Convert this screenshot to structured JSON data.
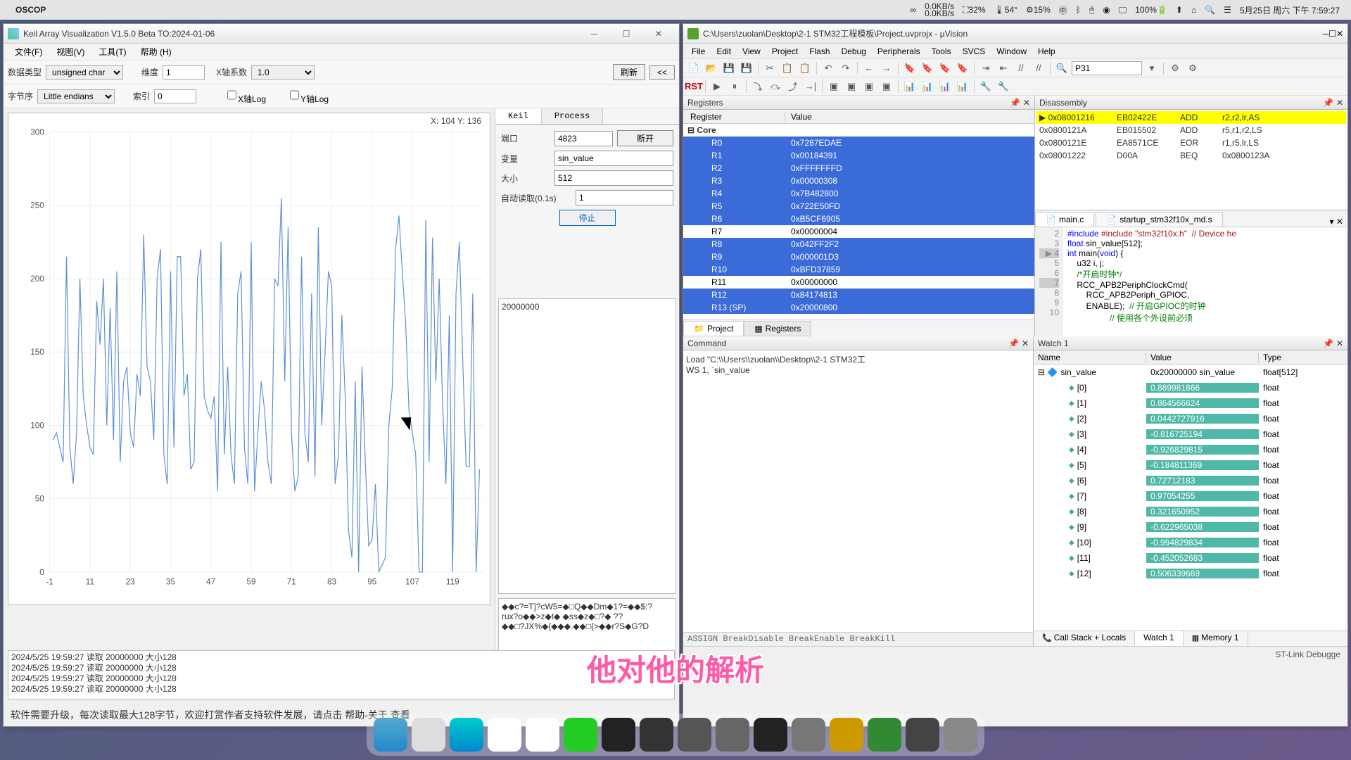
{
  "mac_menu": {
    "app": "OSCOP",
    "net_up": "0.0KB/s",
    "net_down": "0.0KB/s",
    "fan": "32%",
    "temp": "54°",
    "cpu": "15%",
    "battery": "100%",
    "datetime": "5月25日 周六 下午 7:59:27"
  },
  "left": {
    "title": "Keil Array Visualization V1.5.0 Beta TO:2024-01-06",
    "menu": {
      "file": "文件(F)",
      "view": "视图(V)",
      "tools": "工具(T)",
      "help": "帮助 (H)"
    },
    "tb": {
      "data_type_lbl": "数据类型",
      "data_type": "unsigned char",
      "dim_lbl": "维度",
      "dim": "1",
      "xcoef_lbl": "X轴系数",
      "xcoef": "1.0",
      "refresh": "刷新",
      "collapse": "<<",
      "endian_lbl": "字节序",
      "endian": "Little endians",
      "index_lbl": "索引",
      "index": "0",
      "xlog": "X轴Log",
      "ylog": "Y轴Log"
    },
    "chart": {
      "coords": "X: 104 Y: 136",
      "y_ticks": [
        "300",
        "250",
        "200",
        "150",
        "100",
        "50",
        "0"
      ],
      "x_ticks": [
        "-1",
        "11",
        "23",
        "35",
        "47",
        "59",
        "71",
        "83",
        "95",
        "107",
        "119"
      ]
    },
    "side": {
      "tab_keil": "Keil",
      "tab_process": "Process",
      "port_lbl": "端口",
      "port": "4823",
      "disconnect": "断开",
      "var_lbl": "变量",
      "var": "sin_value",
      "size_lbl": "大小",
      "size": "512",
      "auto_lbl": "自动读取(0.1s)",
      "auto": "1",
      "stop": "停止",
      "mono1": "20000000",
      "mono2": "◆◆c?=T]?cW5=◆□Q◆◆Dm◆1?=◆◆$:?\nrux?o◆◆>z◆t◆ ◆ss◆z◆□?◆ ??\n◆◆□?JX%◆{◆◆◆.◆◆□{>◆◆r?S◆G?D"
    },
    "log": [
      "2024/5/25 19:59:27 读取 20000000 大小128",
      "2024/5/25 19:59:27 读取 20000000 大小128",
      "2024/5/25 19:59:27 读取 20000000 大小128",
      "2024/5/25 19:59:27 读取 20000000 大小128"
    ],
    "footer": "软件需要升级，每次读取最大128字节，欢迎打赏作者支持软件发展，请点击 帮助-关于 查看"
  },
  "right": {
    "title": "C:\\Users\\zuolan\\Desktop\\2-1 STM32工程模板\\Project.uvprojx - µVision",
    "menu": [
      "File",
      "Edit",
      "View",
      "Project",
      "Flash",
      "Debug",
      "Peripherals",
      "Tools",
      "SVCS",
      "Window",
      "Help"
    ],
    "jump": "P31",
    "panels": {
      "registers": "Registers",
      "disasm": "Disassembly",
      "command": "Command",
      "watch": "Watch 1"
    },
    "reg_head": {
      "r": "Register",
      "v": "Value"
    },
    "reg_core": "Core",
    "registers": [
      {
        "n": "R0",
        "v": "0x7287EDAE",
        "sel": true
      },
      {
        "n": "R1",
        "v": "0x00184391",
        "sel": true
      },
      {
        "n": "R2",
        "v": "0xFFFFFFFD",
        "sel": true
      },
      {
        "n": "R3",
        "v": "0x00000308",
        "sel": true
      },
      {
        "n": "R4",
        "v": "0x7B482800",
        "sel": true
      },
      {
        "n": "R5",
        "v": "0x722E50FD",
        "sel": true
      },
      {
        "n": "R6",
        "v": "0xB5CF6905",
        "sel": true
      },
      {
        "n": "R7",
        "v": "0x00000004",
        "sel": false
      },
      {
        "n": "R8",
        "v": "0x042FF2F2",
        "sel": true
      },
      {
        "n": "R9",
        "v": "0x000001D3",
        "sel": true
      },
      {
        "n": "R10",
        "v": "0xBFD37859",
        "sel": true
      },
      {
        "n": "R11",
        "v": "0x00000000",
        "sel": false
      },
      {
        "n": "R12",
        "v": "0x84174813",
        "sel": true
      },
      {
        "n": "R13 (SP)",
        "v": "0x20000800",
        "sel": true
      }
    ],
    "disasm": [
      {
        "addr": "0x08001216",
        "opc": "EB02422E",
        "mn": "ADD",
        "args": "r2,r2,lr,AS",
        "hl": true
      },
      {
        "addr": "0x0800121A",
        "opc": "EB015502",
        "mn": "ADD",
        "args": "r5,r1,r2,LS",
        "hl": false
      },
      {
        "addr": "0x0800121E",
        "opc": "EA8571CE",
        "mn": "EOR",
        "args": "r1,r5,lr,LS",
        "hl": false
      },
      {
        "addr": "0x08001222",
        "opc": "D00A",
        "mn": "BEQ",
        "args": "0x0800123A",
        "hl": false
      }
    ],
    "code_tabs": {
      "main": "main.c",
      "startup": "startup_stm32f10x_md.s"
    },
    "code": {
      "lines": [
        2,
        3,
        4,
        5,
        6,
        7,
        8,
        9,
        10
      ],
      "l2": "#include \"stm32f10x.h\"  // Device he",
      "l3": "float sin_value[512];",
      "l4": "int main(void) {",
      "l5": "    u32 i, j;",
      "l6": "    /*开启时钟*/",
      "l7": "    RCC_APB2PeriphClockCmd(",
      "l8": "        RCC_APB2Periph_GPIOC,",
      "l9": "        ENABLE);  // 开启GPIOC的时钟",
      "l10": "                  // 使用各个外设前必须"
    },
    "tabs_bottom": {
      "project": "Project",
      "registers": "Registers"
    },
    "cmd": {
      "line1": "Load \"C:\\\\Users\\\\zuolan\\\\Desktop\\\\2-1 STM32工",
      "line2": "WS 1, `sin_value",
      "hint": "ASSIGN BreakDisable BreakEnable BreakKill"
    },
    "watch_head": {
      "n": "Name",
      "v": "Value",
      "t": "Type"
    },
    "watch_root": {
      "n": "sin_value",
      "v": "0x20000000 sin_value",
      "t": "float[512]"
    },
    "watch": [
      {
        "n": "[0]",
        "v": "0.889981866",
        "t": "float"
      },
      {
        "n": "[1]",
        "v": "0.864566624",
        "t": "float"
      },
      {
        "n": "[2]",
        "v": "0.0442727916",
        "t": "float"
      },
      {
        "n": "[3]",
        "v": "-0.816725194",
        "t": "float"
      },
      {
        "n": "[4]",
        "v": "-0.926829815",
        "t": "float"
      },
      {
        "n": "[5]",
        "v": "-0.184811369",
        "t": "float"
      },
      {
        "n": "[6]",
        "v": "0.72712183",
        "t": "float"
      },
      {
        "n": "[7]",
        "v": "0.97054255",
        "t": "float"
      },
      {
        "n": "[8]",
        "v": "0.321650952",
        "t": "float"
      },
      {
        "n": "[9]",
        "v": "-0.622965038",
        "t": "float"
      },
      {
        "n": "[10]",
        "v": "-0.994829834",
        "t": "float"
      },
      {
        "n": "[11]",
        "v": "-0.452052683",
        "t": "float"
      },
      {
        "n": "[12]",
        "v": "0.506339669",
        "t": "float"
      }
    ],
    "bottom_tabs": {
      "callstack": "Call Stack + Locals",
      "watch": "Watch 1",
      "memory": "Memory 1"
    },
    "status": "ST-Link Debugge"
  },
  "subtitle": "他对他的解析",
  "chart_data": {
    "type": "line",
    "title": "",
    "xlabel": "",
    "ylabel": "",
    "xlim": [
      -1,
      128
    ],
    "ylim": [
      0,
      300
    ],
    "x": [
      0,
      1,
      2,
      3,
      4,
      5,
      6,
      7,
      8,
      9,
      10,
      11,
      12,
      13,
      14,
      15,
      16,
      17,
      18,
      19,
      20,
      21,
      22,
      23,
      24,
      25,
      26,
      27,
      28,
      29,
      30,
      31,
      32,
      33,
      34,
      35,
      36,
      37,
      38,
      39,
      40,
      41,
      42,
      43,
      44,
      45,
      46,
      47,
      48,
      49,
      50,
      51,
      52,
      53,
      54,
      55,
      56,
      57,
      58,
      59,
      60,
      61,
      62,
      63,
      64,
      65,
      66,
      67,
      68,
      69,
      70,
      71,
      72,
      73,
      74,
      75,
      76,
      77,
      78,
      79,
      80,
      81,
      82,
      83,
      84,
      85,
      86,
      87,
      88,
      89,
      90,
      91,
      92,
      93,
      94,
      95,
      96,
      97,
      98,
      99,
      100,
      101,
      102,
      103,
      104,
      105,
      106,
      107,
      108,
      109,
      110,
      111,
      112,
      113,
      114,
      115,
      116,
      117,
      118,
      119,
      120,
      121,
      122,
      123,
      124,
      125,
      126,
      127
    ],
    "values": [
      90,
      95,
      85,
      75,
      215,
      85,
      60,
      95,
      200,
      120,
      100,
      85,
      80,
      185,
      155,
      200,
      100,
      180,
      90,
      205,
      75,
      130,
      140,
      95,
      85,
      135,
      120,
      230,
      140,
      130,
      90,
      200,
      220,
      80,
      60,
      205,
      85,
      215,
      215,
      120,
      135,
      70,
      75,
      200,
      220,
      120,
      110,
      105,
      120,
      55,
      225,
      80,
      140,
      80,
      60,
      190,
      205,
      85,
      60,
      225,
      55,
      95,
      130,
      110,
      75,
      60,
      200,
      195,
      255,
      130,
      235,
      95,
      55,
      65,
      215,
      95,
      75,
      190,
      65,
      235,
      100,
      150,
      205,
      195,
      60,
      80,
      175,
      120,
      28,
      10,
      130,
      0,
      140,
      75,
      18,
      22,
      60,
      0,
      5,
      10,
      100,
      125,
      220,
      243,
      205,
      170,
      110,
      95,
      80,
      0,
      0,
      240,
      75,
      228,
      130,
      200,
      115,
      60,
      175,
      0,
      190,
      225,
      145,
      72,
      72,
      190,
      0,
      70
    ]
  }
}
